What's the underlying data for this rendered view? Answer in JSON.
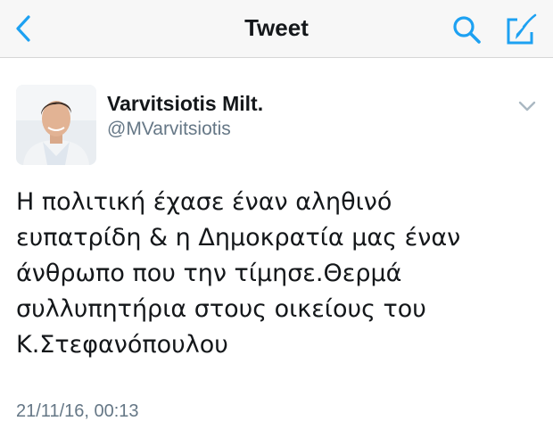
{
  "nav": {
    "title": "Tweet",
    "icons": {
      "back": "back-chevron-icon",
      "search": "search-icon",
      "compose": "compose-icon"
    },
    "accent_color": "#1da1f2"
  },
  "tweet": {
    "author_name": "Varvitsiotis Milt.",
    "author_handle": "@MVarvitsiotis",
    "text_lines": [
      "Η πολιτική έχασε έναν αληθινό",
      "ευπατρίδη & η Δημοκρατία μας έναν",
      "άνθρωπο που την τίμησε.Θερμά",
      "συλλυπητήρια στους οικείους του",
      "Κ.Στεφανόπουλου"
    ],
    "timestamp": "21/11/16, 00:13",
    "menu_icon": "chevron-down-icon"
  }
}
